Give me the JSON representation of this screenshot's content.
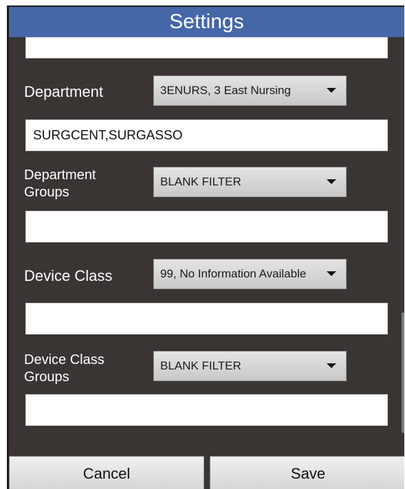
{
  "header": {
    "title": "Settings"
  },
  "fields": {
    "top_empty": "",
    "department_value": "SURGCENT,SURGASSO",
    "department_groups_value": "",
    "device_class_value": "",
    "device_class_groups_value": ""
  },
  "labels": {
    "department": "Department",
    "department_groups_line1": "Department",
    "department_groups_line2": "Groups",
    "device_class": "Device Class",
    "device_class_groups_line1": "Device Class",
    "device_class_groups_line2": "Groups"
  },
  "selects": {
    "department": "3ENURS, 3 East Nursing",
    "department_groups": "BLANK FILTER",
    "device_class": "99, No Information Available",
    "device_class_groups": "BLANK FILTER"
  },
  "buttons": {
    "cancel": "Cancel",
    "save": "Save"
  },
  "icons": {
    "dropdown": "chevron-down-icon"
  },
  "colors": {
    "titlebar": "#4667a8",
    "background": "#3a3533"
  }
}
